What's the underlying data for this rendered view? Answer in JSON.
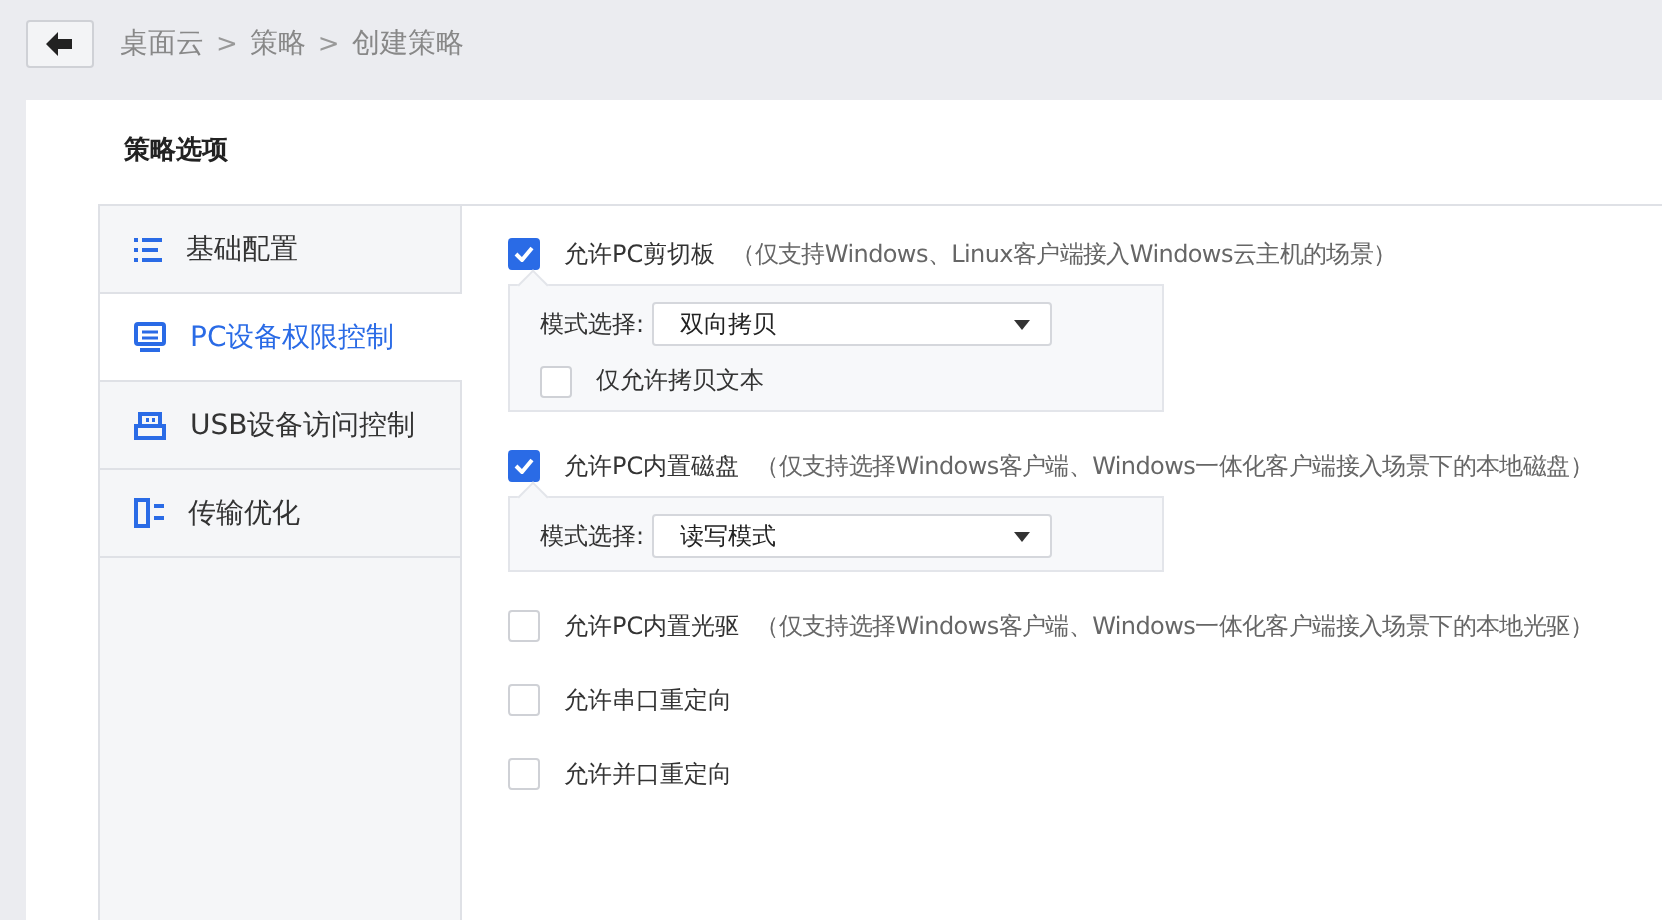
{
  "breadcrumb": [
    "桌面云",
    "策略",
    "创建策略"
  ],
  "separator": ">",
  "section_title": "策略选项",
  "sidebar": {
    "items": [
      {
        "label": "基础配置",
        "kind": "list",
        "selected": false
      },
      {
        "label": "PC设备权限控制",
        "kind": "monitor",
        "selected": true
      },
      {
        "label": "USB设备访问控制",
        "kind": "usb",
        "selected": false
      },
      {
        "label": "传输优化",
        "kind": "transfer",
        "selected": false
      }
    ]
  },
  "options": [
    {
      "label": "允许PC剪切板",
      "note": "（仅支持Windows、Linux客户端接入Windows云主机的场景）",
      "checked": true,
      "panel": {
        "mode_label": "模式选择:",
        "mode_value": "双向拷贝",
        "sub_option": {
          "label": "仅允许拷贝文本",
          "checked": false
        }
      }
    },
    {
      "label": "允许PC内置磁盘",
      "note": "（仅支持选择Windows客户端、Windows一体化客户端接入场景下的本地磁盘）",
      "checked": true,
      "panel": {
        "mode_label": "模式选择:",
        "mode_value": "读写模式"
      }
    },
    {
      "label": "允许PC内置光驱",
      "note": "（仅支持选择Windows客户端、Windows一体化客户端接入场景下的本地光驱）",
      "checked": false
    },
    {
      "label": "允许串口重定向",
      "checked": false
    },
    {
      "label": "允许并口重定向",
      "checked": false
    }
  ]
}
